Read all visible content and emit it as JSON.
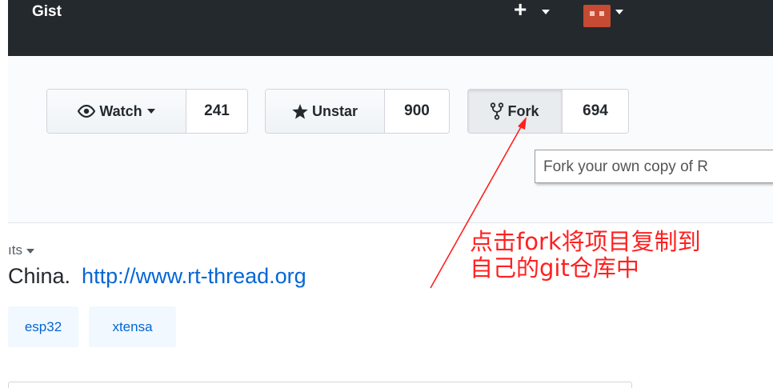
{
  "header": {
    "title": "Gist",
    "new_icon": "plus-icon",
    "avatar_icon": "user-avatar"
  },
  "actions": {
    "watch": {
      "label": "Watch",
      "count": "241",
      "icon": "eye-icon"
    },
    "star": {
      "label": "Unstar",
      "count": "900",
      "icon": "star-icon"
    },
    "fork": {
      "label": "Fork",
      "count": "694",
      "icon": "fork-icon"
    }
  },
  "tooltip": {
    "text": "Fork your own copy of R"
  },
  "nav": {
    "insights_label": "ıts"
  },
  "about": {
    "description": "China.",
    "website": "http://www.rt-thread.org"
  },
  "topics": [
    "esp32",
    "xtensa"
  ],
  "annotation": {
    "line1": "点击fork将项目复制到",
    "line2": "自己的git仓库中",
    "color": "#ff2020"
  },
  "colors": {
    "header_bg": "#24292e",
    "link": "#0366d6",
    "topic_bg": "#f1f8ff"
  }
}
